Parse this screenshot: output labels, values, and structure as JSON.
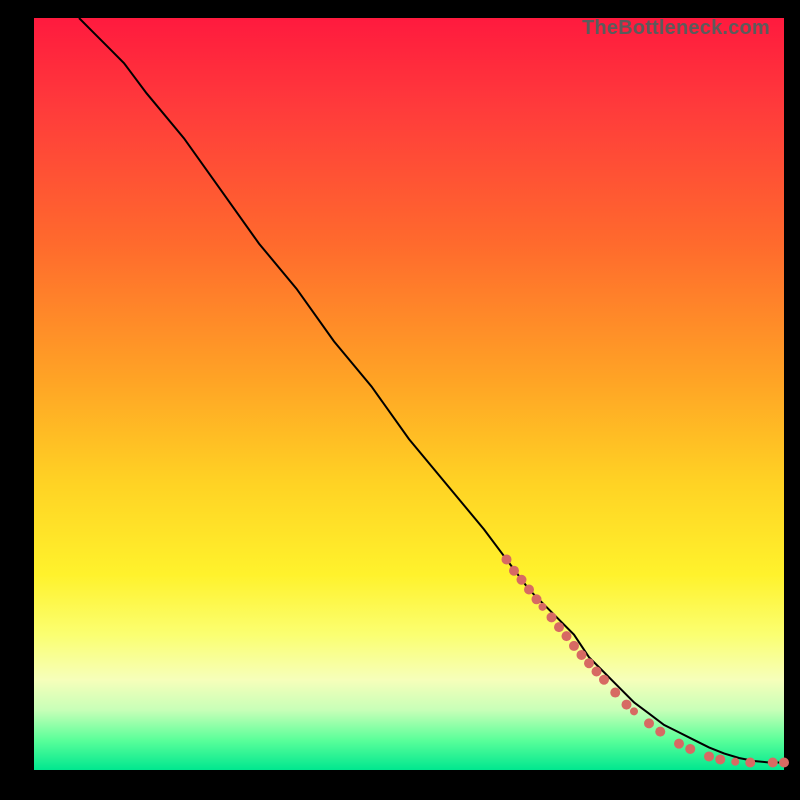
{
  "watermark": "TheBottleneck.com",
  "chart_data": {
    "type": "line",
    "title": "",
    "xlabel": "",
    "ylabel": "",
    "xlim": [
      0,
      100
    ],
    "ylim": [
      0,
      100
    ],
    "background_gradient": {
      "top": "#ff1a3e",
      "mid_upper": "#ffa325",
      "mid_lower": "#fff22c",
      "bottom": "#00e78f"
    },
    "series": [
      {
        "name": "bottleneck-curve",
        "stroke": "#000000",
        "x": [
          6,
          8,
          10,
          12,
          15,
          20,
          25,
          30,
          35,
          40,
          45,
          50,
          55,
          60,
          63,
          66,
          69,
          72,
          74,
          76,
          78,
          80,
          82,
          84,
          86,
          88,
          90,
          92,
          94,
          96,
          98,
          100
        ],
        "y": [
          100,
          98,
          96,
          94,
          90,
          84,
          77,
          70,
          64,
          57,
          51,
          44,
          38,
          32,
          28,
          24,
          21,
          18,
          15,
          13,
          11,
          9,
          7.5,
          6,
          5,
          4,
          3,
          2.2,
          1.6,
          1.2,
          1,
          1
        ]
      }
    ],
    "markers": {
      "name": "highlight-dots",
      "fill": "#d76a63",
      "points": [
        {
          "x": 63,
          "y": 28,
          "r": 5
        },
        {
          "x": 64,
          "y": 26.5,
          "r": 5
        },
        {
          "x": 65,
          "y": 25.3,
          "r": 5
        },
        {
          "x": 66,
          "y": 24,
          "r": 5
        },
        {
          "x": 67,
          "y": 22.7,
          "r": 5
        },
        {
          "x": 67.8,
          "y": 21.7,
          "r": 4
        },
        {
          "x": 69,
          "y": 20.3,
          "r": 5
        },
        {
          "x": 70,
          "y": 19,
          "r": 5
        },
        {
          "x": 71,
          "y": 17.8,
          "r": 5
        },
        {
          "x": 72,
          "y": 16.5,
          "r": 5
        },
        {
          "x": 73,
          "y": 15.3,
          "r": 5
        },
        {
          "x": 74,
          "y": 14.2,
          "r": 5
        },
        {
          "x": 75,
          "y": 13.1,
          "r": 5
        },
        {
          "x": 76,
          "y": 12,
          "r": 5
        },
        {
          "x": 77.5,
          "y": 10.3,
          "r": 5
        },
        {
          "x": 79,
          "y": 8.7,
          "r": 5
        },
        {
          "x": 80,
          "y": 7.8,
          "r": 4
        },
        {
          "x": 82,
          "y": 6.2,
          "r": 5
        },
        {
          "x": 83.5,
          "y": 5.1,
          "r": 5
        },
        {
          "x": 86,
          "y": 3.5,
          "r": 5
        },
        {
          "x": 87.5,
          "y": 2.8,
          "r": 5
        },
        {
          "x": 90,
          "y": 1.8,
          "r": 5
        },
        {
          "x": 91.5,
          "y": 1.4,
          "r": 5
        },
        {
          "x": 93.5,
          "y": 1.1,
          "r": 4
        },
        {
          "x": 95.5,
          "y": 1.0,
          "r": 5
        },
        {
          "x": 98.5,
          "y": 1.0,
          "r": 5
        },
        {
          "x": 100,
          "y": 1.0,
          "r": 5
        }
      ]
    }
  }
}
